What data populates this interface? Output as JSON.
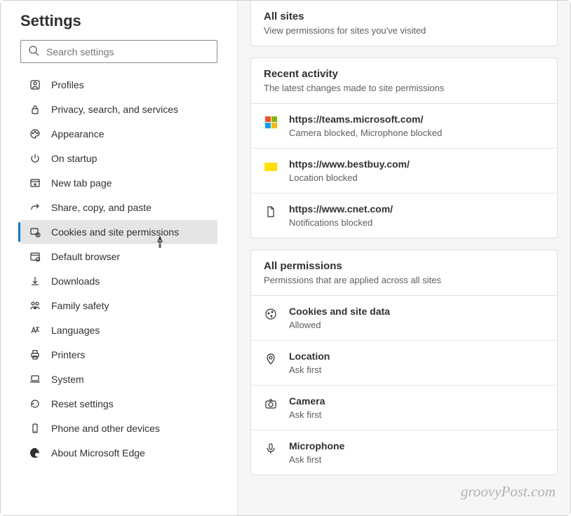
{
  "sidebar": {
    "title": "Settings",
    "search_placeholder": "Search settings",
    "items": [
      {
        "icon": "profile-icon",
        "label": "Profiles"
      },
      {
        "icon": "lock-icon",
        "label": "Privacy, search, and services"
      },
      {
        "icon": "palette-icon",
        "label": "Appearance"
      },
      {
        "icon": "power-icon",
        "label": "On startup"
      },
      {
        "icon": "tab-icon",
        "label": "New tab page"
      },
      {
        "icon": "share-icon",
        "label": "Share, copy, and paste"
      },
      {
        "icon": "cookie-perm-icon",
        "label": "Cookies and site permissions",
        "active": true
      },
      {
        "icon": "browser-icon",
        "label": "Default browser"
      },
      {
        "icon": "download-icon",
        "label": "Downloads"
      },
      {
        "icon": "family-icon",
        "label": "Family safety"
      },
      {
        "icon": "language-icon",
        "label": "Languages"
      },
      {
        "icon": "printer-icon",
        "label": "Printers"
      },
      {
        "icon": "laptop-icon",
        "label": "System"
      },
      {
        "icon": "reset-icon",
        "label": "Reset settings"
      },
      {
        "icon": "phone-icon",
        "label": "Phone and other devices"
      },
      {
        "icon": "edge-icon",
        "label": "About Microsoft Edge"
      }
    ]
  },
  "main": {
    "all_sites": {
      "title": "All sites",
      "subtitle": "View permissions for sites you've visited"
    },
    "recent_activity": {
      "title": "Recent activity",
      "subtitle": "The latest changes made to site permissions",
      "items": [
        {
          "icon": "microsoft",
          "url": "https://teams.microsoft.com/",
          "status": "Camera blocked, Microphone blocked"
        },
        {
          "icon": "bestbuy",
          "url": "https://www.bestbuy.com/",
          "status": "Location blocked"
        },
        {
          "icon": "file",
          "url": "https://www.cnet.com/",
          "status": "Notifications blocked"
        }
      ]
    },
    "all_permissions": {
      "title": "All permissions",
      "subtitle": "Permissions that are applied across all sites",
      "items": [
        {
          "icon": "cookie",
          "title": "Cookies and site data",
          "status": "Allowed"
        },
        {
          "icon": "location",
          "title": "Location",
          "status": "Ask first"
        },
        {
          "icon": "camera",
          "title": "Camera",
          "status": "Ask first"
        },
        {
          "icon": "microphone",
          "title": "Microphone",
          "status": "Ask first"
        }
      ]
    }
  },
  "watermark": "groovyPost.com"
}
